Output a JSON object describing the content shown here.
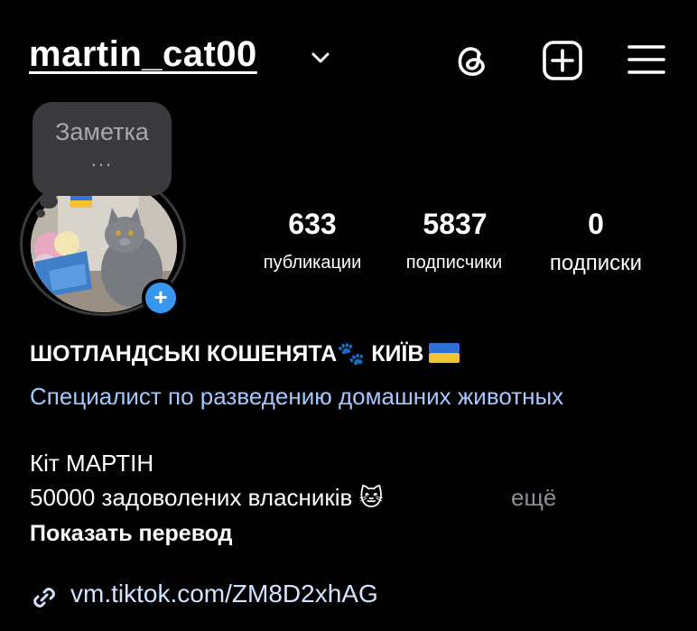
{
  "header": {
    "username": "martin_cat00",
    "dropdown_icon": "chevron-down-icon",
    "threads_icon": "threads-icon",
    "new_post_icon": "plus-square-icon",
    "menu_icon": "hamburger-menu-icon"
  },
  "note": {
    "label": "Заметка",
    "dots": "..."
  },
  "stats": {
    "posts": {
      "value": "633",
      "label": "публикации"
    },
    "followers": {
      "value": "5837",
      "label": "подписчики"
    },
    "following": {
      "value": "0",
      "label": "подписки"
    }
  },
  "bio": {
    "name": "ШОТЛАНДСЬКІ КОШЕНЯТА🐾 КИЇВ",
    "category": "Специалист по разведению домашних животных",
    "line3": "Кіт МАРТІН",
    "line4": "50000 задоволених власників 🐱",
    "more": "ещё",
    "translate": "Показать перевод",
    "link": "vm.tiktok.com/ZM8D2xhAG"
  },
  "colors": {
    "background": "#000000",
    "accent_blue": "#3797f0",
    "category_text": "#a7c7ff",
    "muted": "#8e8e93"
  }
}
